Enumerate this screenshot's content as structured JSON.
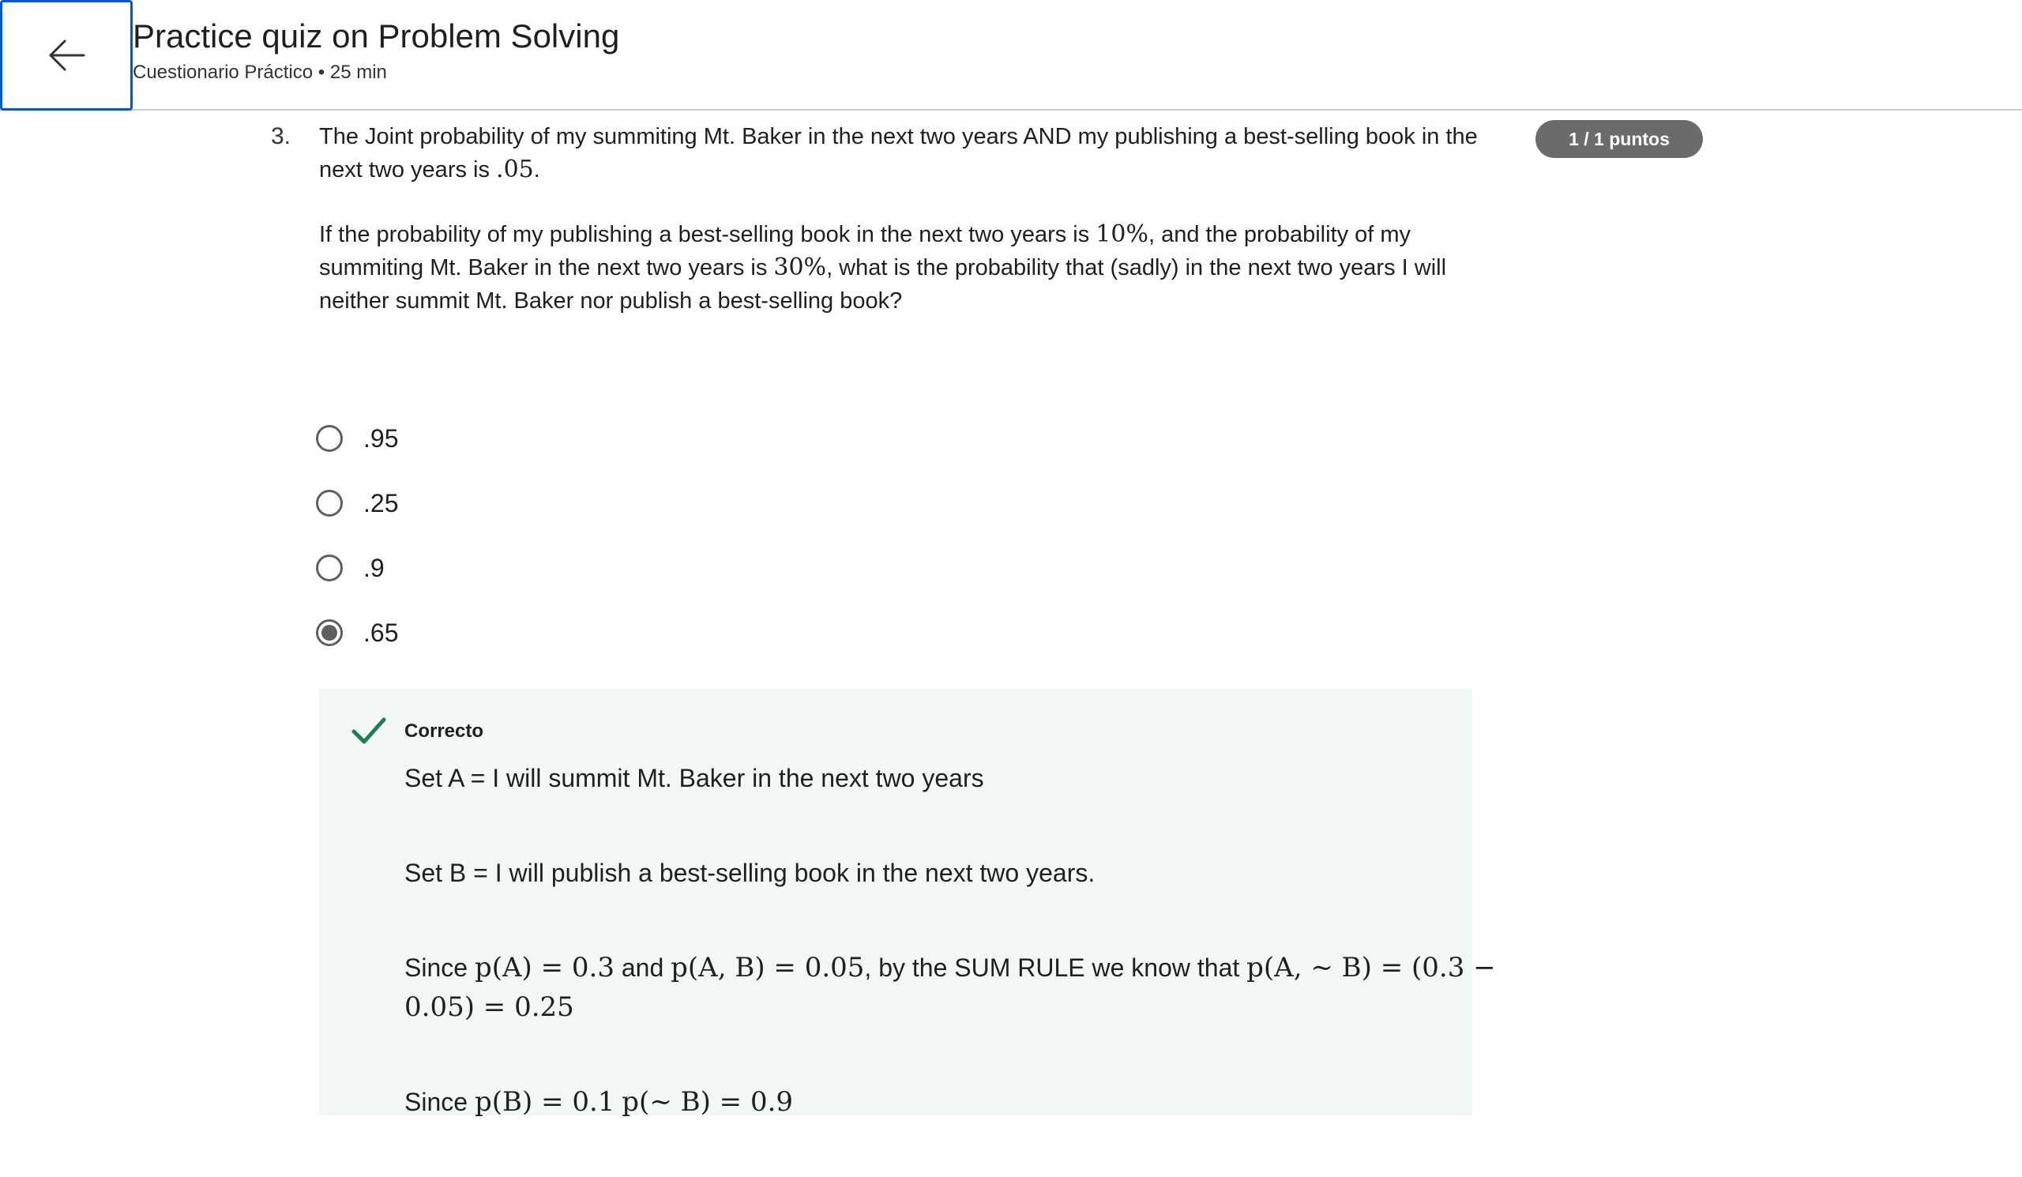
{
  "header": {
    "title": "Practice quiz on Problem Solving",
    "subtitle": "Cuestionario Práctico • 25 min"
  },
  "question": {
    "number": "3.",
    "score_badge": "1 / 1 puntos",
    "para1_text_a": "The Joint probability of my summiting Mt. Baker in the next two years AND my publishing a best-selling book in the next two years is ",
    "para1_math_a": ".05",
    "para1_text_b": ".",
    "para2_text_a": "If the probability of my publishing a best-selling book in the next two years is ",
    "para2_math_a": "10%",
    "para2_text_b": ", and the probability of my summiting Mt. Baker in the next two years is ",
    "para2_math_b": "30%",
    "para2_text_c": ", what is the probability that (sadly) in the next two years I will neither summit Mt. Baker nor publish a best-selling book?"
  },
  "options": [
    {
      "label": ".95",
      "selected": false
    },
    {
      "label": ".25",
      "selected": false
    },
    {
      "label": ".9",
      "selected": false
    },
    {
      "label": ".65",
      "selected": true
    }
  ],
  "feedback": {
    "status": "Correcto",
    "check_icon_color": "#1e7d53",
    "line1": "Set A = I will summit Mt. Baker in the next two years",
    "line2": "Set B = I will publish a best-selling book in the next two years.",
    "line3_a": "Since ",
    "line3_math_a": "p(A) = 0.3",
    "line3_b": " and ",
    "line3_math_b": "p(A, B) = 0.05",
    "line3_c": ", by the SUM RULE we know that ",
    "line3_math_c": "p(A, ∼ B) = (0.3 − 0.05) = 0.25",
    "line4_a": "Since ",
    "line4_math_a": "p(B) = 0.1",
    "line4_b": " ",
    "line4_math_b": "p(∼ B) = 0.9"
  },
  "icons": {
    "back": "arrow-left-icon",
    "check": "check-icon"
  }
}
